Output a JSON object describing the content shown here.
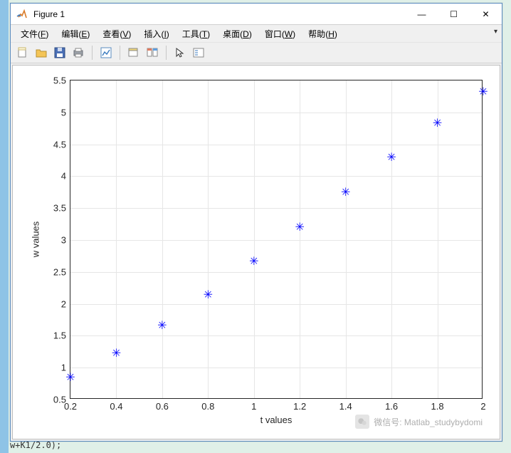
{
  "window": {
    "title": "Figure 1",
    "minimize_glyph": "—",
    "maximize_glyph": "☐",
    "close_glyph": "✕"
  },
  "menu": {
    "file": {
      "label": "文件",
      "accel": "F"
    },
    "edit": {
      "label": "编辑",
      "accel": "E"
    },
    "view": {
      "label": "查看",
      "accel": "V"
    },
    "insert": {
      "label": "插入",
      "accel": "I"
    },
    "tools": {
      "label": "工具",
      "accel": "T"
    },
    "desktop": {
      "label": "桌面",
      "accel": "D"
    },
    "windowm": {
      "label": "窗口",
      "accel": "W"
    },
    "help": {
      "label": "帮助",
      "accel": "H"
    }
  },
  "toolbar": {
    "new": "new-figure",
    "open": "open",
    "save": "save",
    "print": "print",
    "sep1": "|",
    "edit": "edit-plot",
    "sep2": "|",
    "inspect": "property-inspector",
    "linked": "linked-plot",
    "sep3": "|",
    "pointer": "pointer",
    "insert": "insert-legend"
  },
  "watermark": {
    "text": "微信号: Matlab_studybydomi"
  },
  "bg_editor_line": "w+K1/2.0);",
  "chart_data": {
    "type": "scatter",
    "marker": "*",
    "color": "#0000ff",
    "xlabel": "t values",
    "ylabel": "w values",
    "xlim": [
      0.2,
      2.0
    ],
    "ylim": [
      0.5,
      5.5
    ],
    "xticks": [
      0.2,
      0.4,
      0.6,
      0.8,
      1.0,
      1.2,
      1.4,
      1.6,
      1.8,
      2.0
    ],
    "yticks": [
      0.5,
      1.0,
      1.5,
      2.0,
      2.5,
      3.0,
      3.5,
      4.0,
      4.5,
      5.0,
      5.5
    ],
    "x": [
      0.2,
      0.4,
      0.6,
      0.8,
      1.0,
      1.2,
      1.4,
      1.6,
      1.8,
      2.0
    ],
    "y": [
      0.83,
      1.21,
      1.65,
      2.13,
      2.65,
      3.19,
      3.74,
      4.28,
      4.82,
      5.31
    ],
    "grid": true
  }
}
